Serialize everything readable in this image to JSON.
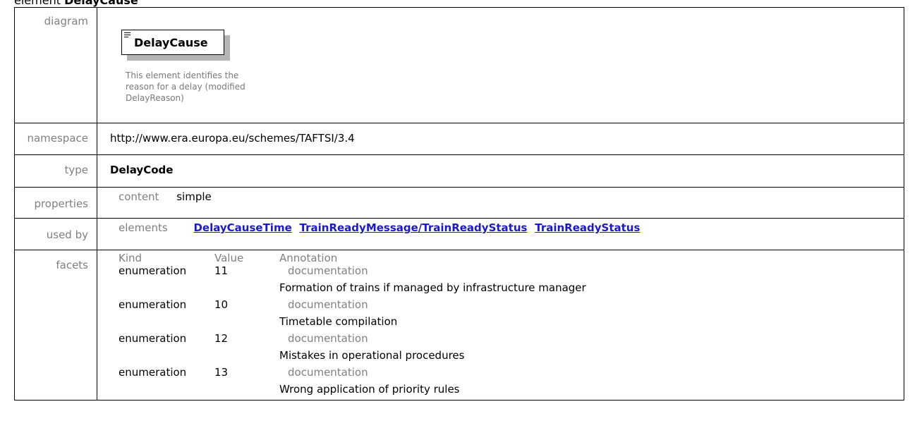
{
  "heading": {
    "prefix": "element",
    "name": "DelayCause"
  },
  "rows": {
    "diagram": {
      "label": "diagram",
      "element_name": "DelayCause",
      "description": "This element identifies the\nreason for a delay (modified\nDelayReason)"
    },
    "namespace": {
      "label": "namespace",
      "value": "http://www.era.europa.eu/schemes/TAFTSI/3.4"
    },
    "type": {
      "label": "type",
      "value": "DelayCode"
    },
    "properties": {
      "label": "properties",
      "key": "content",
      "value": "simple"
    },
    "used_by": {
      "label": "used by",
      "key": "elements",
      "links": [
        "DelayCauseTime",
        "TrainReadyMessage/TrainReadyStatus",
        "TrainReadyStatus"
      ]
    },
    "facets": {
      "label": "facets",
      "headers": {
        "kind": "Kind",
        "value": "Value",
        "annotation": "Annotation"
      },
      "items": [
        {
          "kind": "enumeration",
          "value": "11",
          "ann_key": "documentation",
          "ann_text": "Formation of trains if managed by infrastructure manager"
        },
        {
          "kind": "enumeration",
          "value": "10",
          "ann_key": "documentation",
          "ann_text": "Timetable compilation"
        },
        {
          "kind": "enumeration",
          "value": "12",
          "ann_key": "documentation",
          "ann_text": "Mistakes in operational procedures"
        },
        {
          "kind": "enumeration",
          "value": "13",
          "ann_key": "documentation",
          "ann_text": "Wrong application of priority rules"
        }
      ]
    }
  },
  "colors": {
    "label_gray": "#808080",
    "link_blue": "#1a1acc",
    "shadow_gray": "#b5b5b5"
  }
}
